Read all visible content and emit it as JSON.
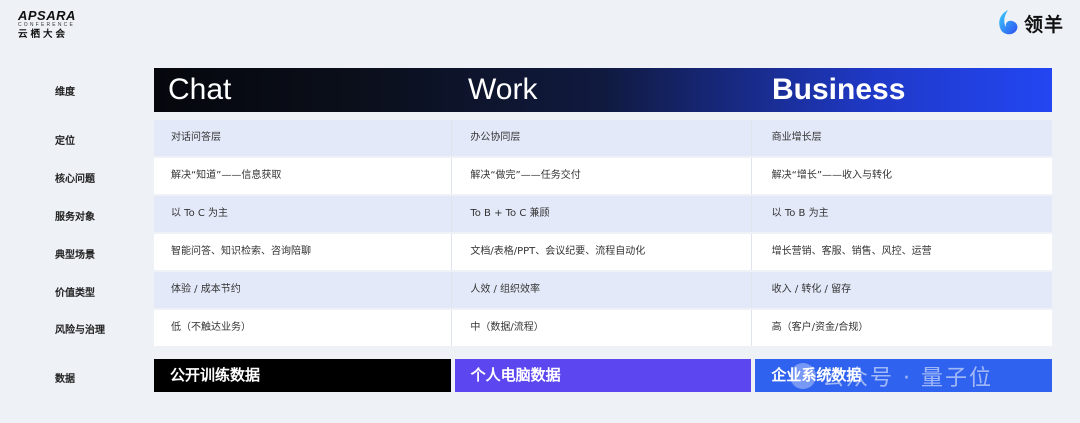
{
  "branding": {
    "left_logo": {
      "line1": "APSARA",
      "line2": "CONFERENCE",
      "line3": "云栖大会"
    },
    "right_logo": {
      "name": "领羊",
      "icon": "wave-logo-icon"
    }
  },
  "headers": [
    "Chat",
    "Work",
    "Business"
  ],
  "row_labels": [
    "维度",
    "定位",
    "核心问题",
    "服务对象",
    "典型场景",
    "价值类型",
    "风险与治理",
    "数据"
  ],
  "rows": [
    [
      "对话问答层",
      "办公协同层",
      "商业增长层"
    ],
    [
      "解决“知道”——信息获取",
      "解决“做完”——任务交付",
      "解决“增长”——收入与转化"
    ],
    [
      "以 To C 为主",
      "To B + To C 兼顾",
      "以 To B 为主"
    ],
    [
      "智能问答、知识检索、咨询陪聊",
      "文档/表格/PPT、会议纪要、流程自动化",
      "增长营销、客服、销售、风控、运营"
    ],
    [
      "体验 / 成本节约",
      "人效 / 组织效率",
      "收入 / 转化 / 留存"
    ],
    [
      "低（不触达业务）",
      "中（数据/流程）",
      "高（客户/资金/合规）"
    ]
  ],
  "data_boxes": [
    "公开训练数据",
    "个人电脑数据",
    "企业系统数据"
  ],
  "watermark": "公众号 · 量子位",
  "colors": {
    "chat": "#000000",
    "work": "#5b46f0",
    "business": "#2f62ee",
    "row_alt": "#e4e9f9"
  }
}
